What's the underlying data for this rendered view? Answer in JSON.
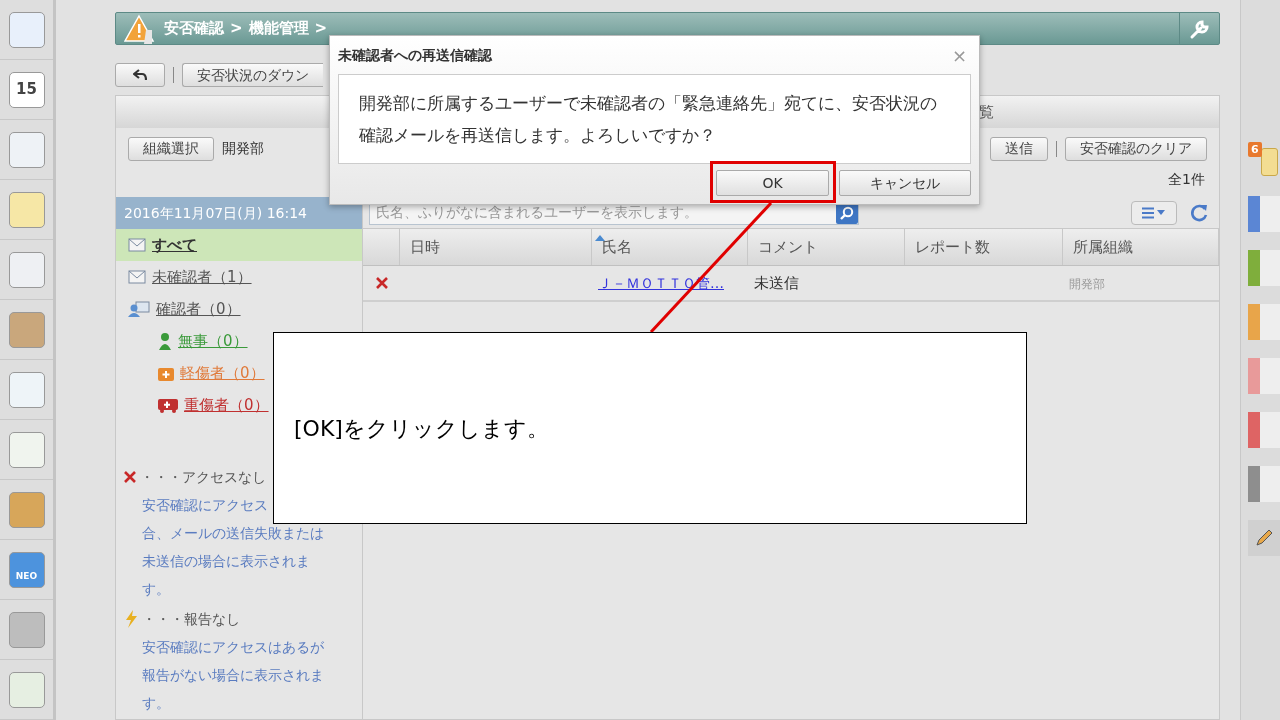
{
  "dock": {
    "calendar_day": "15",
    "neo_label": "NEO"
  },
  "header": {
    "breadcrumb": [
      "安否確認",
      ">",
      "機能管理",
      ">"
    ]
  },
  "toolbar": {
    "download_button": "安否状況のダウン"
  },
  "panel": {
    "title_fragment": "覧",
    "org_button": "組織選択",
    "org_name": "開発部",
    "resend_button": "送信",
    "clear_button": "安否確認のクリア",
    "total": "全1件"
  },
  "sidebar": {
    "date": "2016年11月07日(月) 16:14",
    "items": [
      {
        "label": "すべて",
        "kind": "mail",
        "selected": true,
        "color": "#333333"
      },
      {
        "label": "未確認者（1）",
        "kind": "mail",
        "selected": false,
        "color": "#555555"
      },
      {
        "label": "確認者（0）",
        "kind": "people",
        "selected": false,
        "color": "#555555",
        "children": [
          {
            "label": "無事（0）",
            "kind": "person",
            "selected": false,
            "color": "#3a9a3a"
          },
          {
            "label": "軽傷者（0）",
            "kind": "aid",
            "selected": false,
            "color": "#e07a3a"
          },
          {
            "label": "重傷者（0）",
            "kind": "ambulance",
            "selected": false,
            "color": "#c03030"
          }
        ]
      }
    ],
    "legend": [
      {
        "kind": "cross",
        "label": "・・・アクセスなし",
        "lines": [
          "安否確認にアクセス",
          "合、メールの送信失敗または",
          "未送信の場合に表示されま",
          "す。"
        ]
      },
      {
        "kind": "bolt",
        "label": "・・・報告なし",
        "lines": [
          "安否確認にアクセスはあるが",
          "報告がない場合に表示されま",
          "す。"
        ]
      }
    ]
  },
  "search": {
    "placeholder": "氏名、ふりがなに含まれるユーザーを表示します。"
  },
  "table": {
    "columns": [
      "日時",
      "氏名",
      "コメント",
      "レポート数",
      "所属組織"
    ],
    "rows": [
      {
        "accessed": false,
        "date": "",
        "name": "Ｊ－ＭＯＴＴＯ管…",
        "comment": "未送信",
        "reports": "",
        "org": "開発部"
      }
    ]
  },
  "right_dock": {
    "badge": "6",
    "tabs": [
      {
        "color": "#5b86d4"
      },
      {
        "color": "#7fae3c"
      },
      {
        "color": "#e8a54a"
      },
      {
        "color": "#e89a9a"
      },
      {
        "color": "#de6464"
      },
      {
        "color": "#8e8e8e"
      }
    ]
  },
  "dialog": {
    "title": "未確認者への再送信確認",
    "close": "×",
    "message": "開発部に所属するユーザーで未確認者の「緊急連絡先」宛てに、安否状況の確認メールを再送信します。よろしいですか？",
    "buttons": [
      "OK",
      "キャンセル"
    ]
  },
  "callout": {
    "text": "[OK]をクリックします。"
  }
}
